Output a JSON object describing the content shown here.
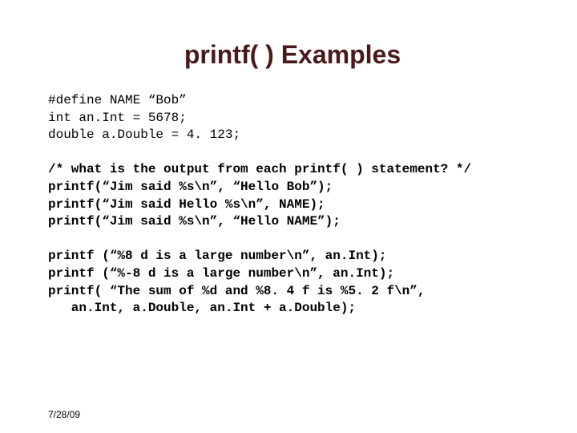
{
  "slide": {
    "title": "printf( ) Examples",
    "block1_l1": "#define NAME “Bob”",
    "block1_l2": "int an.Int = 5678;",
    "block1_l3": "double a.Double = 4. 123;",
    "block2_l1": "/* what is the output from each printf( ) statement? */",
    "block2_l2": "printf(“Jim said %s\\n”, “Hello Bob”);",
    "block2_l3": "printf(“Jim said Hello %s\\n”, NAME);",
    "block2_l4": "printf(“Jim said %s\\n”, “Hello NAME”);",
    "block3_l1": "printf (“%8 d is a large number\\n”, an.Int);",
    "block3_l2": "printf (“%-8 d is a large number\\n”, an.Int);",
    "block3_l3": "printf( “The sum of %d and %8. 4 f is %5. 2 f\\n”,",
    "block3_l4": "   an.Int, a.Double, an.Int + a.Double);",
    "date": "7/28/09"
  }
}
